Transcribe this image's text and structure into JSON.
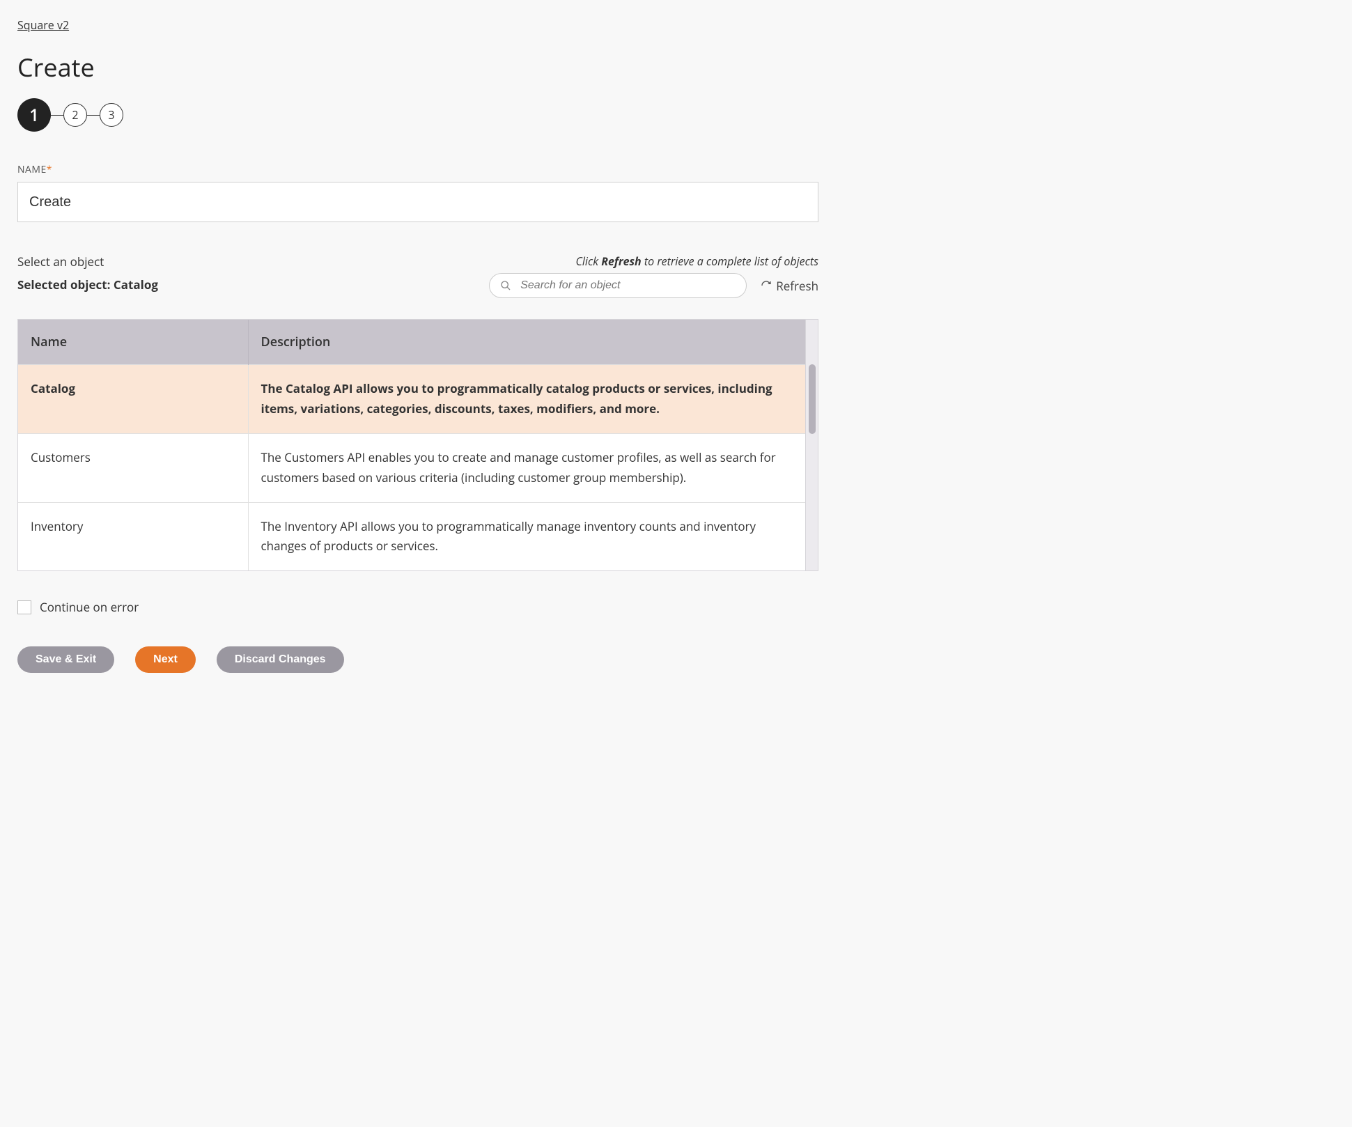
{
  "breadcrumb": "Square v2",
  "pageTitle": "Create",
  "stepper": {
    "steps": [
      "1",
      "2",
      "3"
    ],
    "activeIndex": 0
  },
  "nameField": {
    "label": "NAME",
    "value": "Create"
  },
  "objectSection": {
    "selectLabel": "Select an object",
    "selectedPrefix": "Selected object: ",
    "selectedValue": "Catalog",
    "helperPrefix": "Click ",
    "helperBold": "Refresh",
    "helperSuffix": " to retrieve a complete list of objects",
    "searchPlaceholder": "Search for an object",
    "refreshLabel": "Refresh"
  },
  "table": {
    "headers": {
      "name": "Name",
      "description": "Description"
    },
    "rows": [
      {
        "name": "Catalog",
        "description": "The Catalog API allows you to programmatically catalog products or services, including items, variations, categories, discounts, taxes, modifiers, and more.",
        "selected": true
      },
      {
        "name": "Customers",
        "description": "The Customers API enables you to create and manage customer profiles, as well as search for customers based on various criteria (including customer group membership).",
        "selected": false
      },
      {
        "name": "Inventory",
        "description": "The Inventory API allows you to programmatically manage inventory counts and inventory changes of products or services.",
        "selected": false
      }
    ]
  },
  "continueOnError": {
    "label": "Continue on error",
    "checked": false
  },
  "buttons": {
    "saveExit": "Save & Exit",
    "next": "Next",
    "discard": "Discard Changes"
  }
}
